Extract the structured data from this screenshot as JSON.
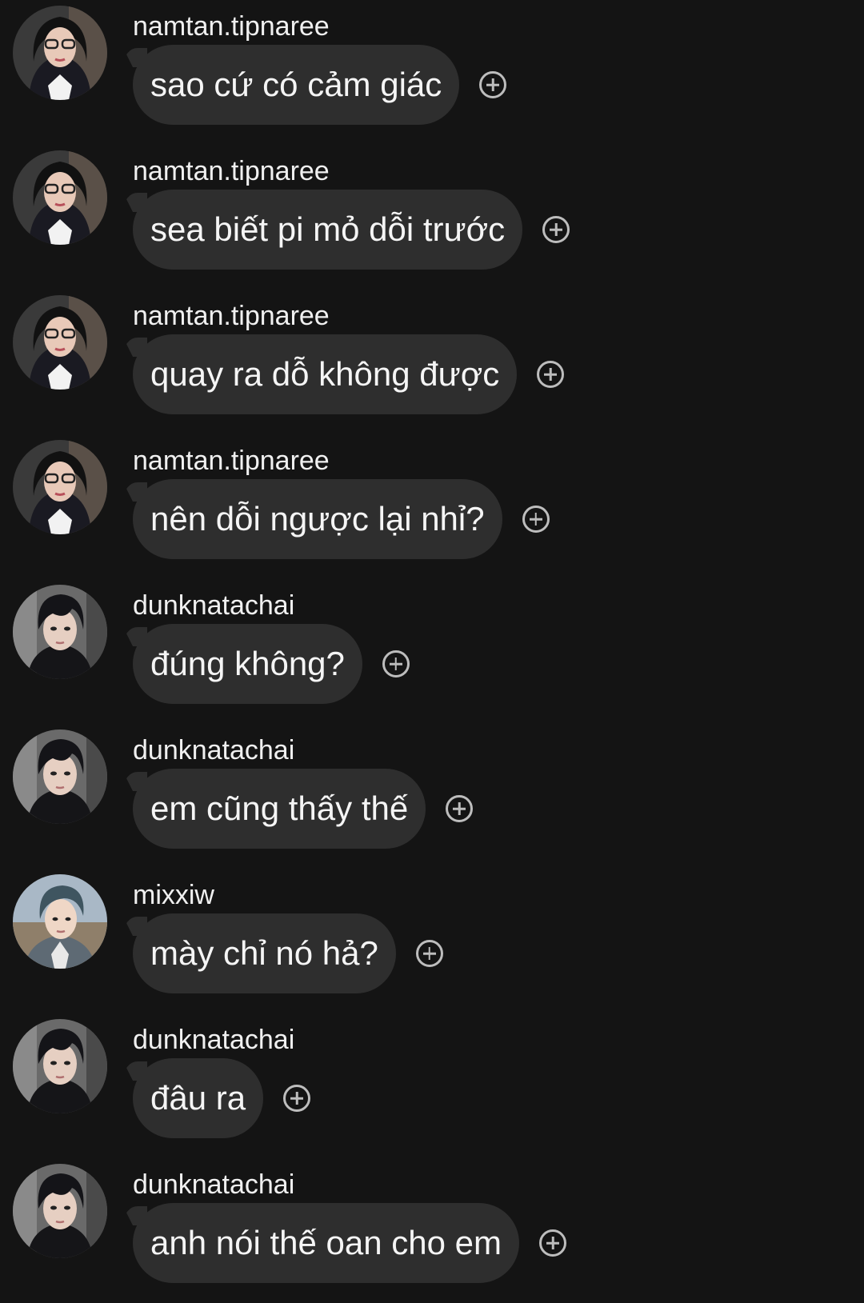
{
  "colors": {
    "background": "#141414",
    "bubble": "#2e2e2e",
    "text": "#f5f5f5",
    "icon": "#bdbdbd"
  },
  "messages": [
    {
      "sender": "namtan.tipnaree",
      "text": "sao cứ có cảm giác",
      "avatar": "avatar-namtan"
    },
    {
      "sender": "namtan.tipnaree",
      "text": "sea biết pi mỏ dỗi trước",
      "avatar": "avatar-namtan"
    },
    {
      "sender": "namtan.tipnaree",
      "text": "quay ra dỗ không được",
      "avatar": "avatar-namtan"
    },
    {
      "sender": "namtan.tipnaree",
      "text": "nên dỗi ngược lại nhỉ?",
      "avatar": "avatar-namtan"
    },
    {
      "sender": "dunknatachai",
      "text": "đúng không?",
      "avatar": "avatar-dunk"
    },
    {
      "sender": "dunknatachai",
      "text": "em cũng thấy thế",
      "avatar": "avatar-dunk"
    },
    {
      "sender": "mixxiw",
      "text": "mày chỉ nó hả?",
      "avatar": "avatar-mixxiw"
    },
    {
      "sender": "dunknatachai",
      "text": "đâu ra",
      "avatar": "avatar-dunk"
    },
    {
      "sender": "dunknatachai",
      "text": "anh nói thế oan cho em",
      "avatar": "avatar-dunk"
    }
  ],
  "react_icon": "add-reaction-icon"
}
